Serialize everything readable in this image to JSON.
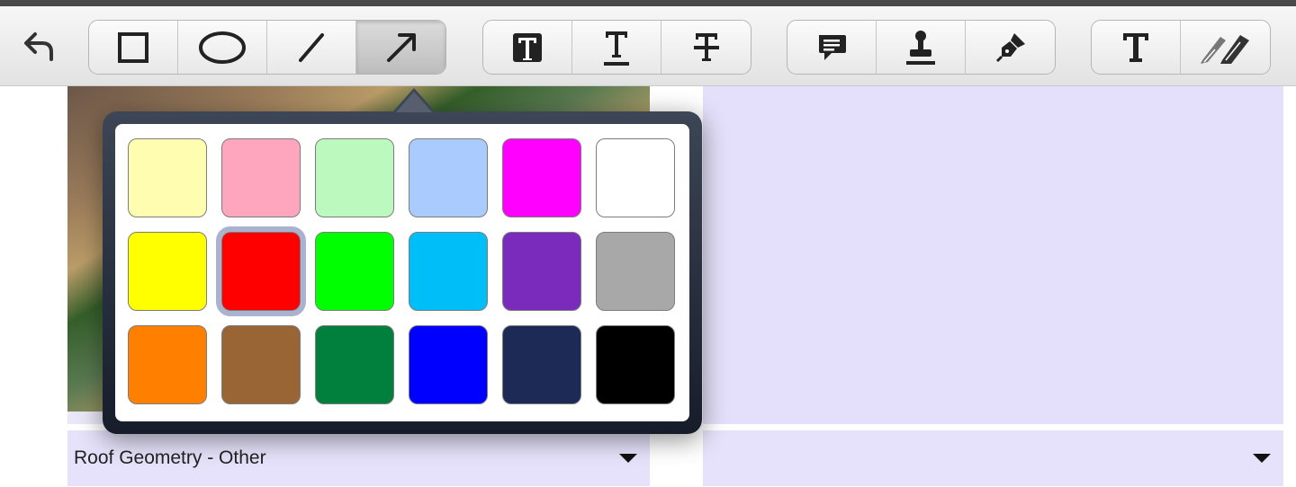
{
  "toolbar": {
    "undo_icon": "undo-icon",
    "groups": [
      {
        "name": "shapes",
        "items": [
          "rectangle-icon",
          "ellipse-icon",
          "line-icon",
          "arrow-icon"
        ],
        "active": "arrow-icon"
      },
      {
        "name": "text-styles",
        "items": [
          "text-box-icon",
          "text-underline-icon",
          "text-strikethrough-icon"
        ]
      },
      {
        "name": "annotations",
        "items": [
          "comment-icon",
          "stamp-icon",
          "pen-icon"
        ]
      },
      {
        "name": "text-tools",
        "items": [
          "text-icon",
          "highlighter-icon"
        ]
      }
    ]
  },
  "colors": {
    "accent_selected": "#a9b3cf",
    "panel_bg": "#e4e0fb"
  },
  "palette": {
    "selected_index": 7,
    "swatches": [
      "#fffdb0",
      "#ffa6bf",
      "#bcf9be",
      "#a9cbfd",
      "#ff00ff",
      "#ffffff",
      "#ffff00",
      "#ff0000",
      "#00ff00",
      "#00bff8",
      "#7b2bbb",
      "#a8a8a8",
      "#ff7f00",
      "#9a6534",
      "#00803c",
      "#0000ff",
      "#1c2a55",
      "#000000"
    ]
  },
  "photo": {
    "label_left": "Roof Geometry - Other"
  },
  "dropdown_right": {
    "value": ""
  }
}
